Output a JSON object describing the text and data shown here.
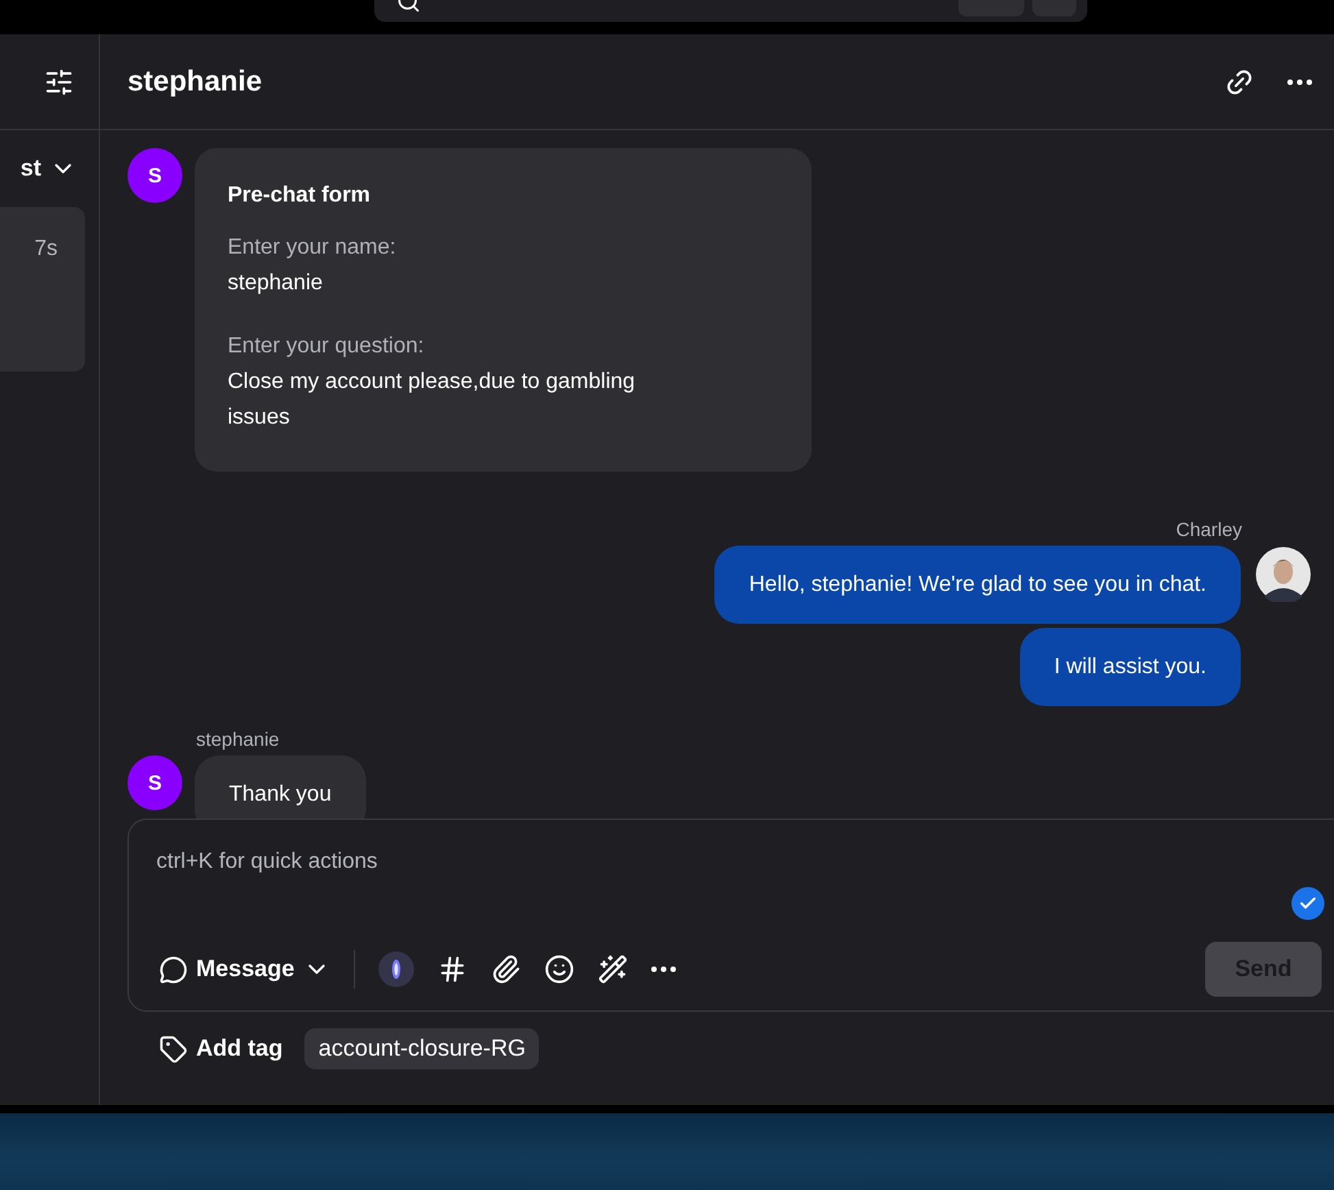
{
  "sidebar": {
    "filter_label": "st",
    "conversations": [
      {
        "time": "7s",
        "selected": true
      }
    ]
  },
  "chat": {
    "title": "stephanie"
  },
  "messages": [
    {
      "kind": "form",
      "avatar": "S",
      "title": "Pre-chat form",
      "fields": [
        {
          "label": "Enter your name:",
          "value": "stephanie"
        },
        {
          "label": "Enter your question:",
          "value": "Close my account please,due to gambling issues"
        }
      ]
    },
    {
      "kind": "agent",
      "sender": "Charley",
      "bubbles": [
        "Hello, stephanie! We're glad to see you in chat.",
        "I will assist you."
      ]
    },
    {
      "kind": "visitor",
      "sender": "stephanie",
      "avatar": "S",
      "bubbles": [
        "Thank you"
      ]
    }
  ],
  "composer": {
    "placeholder": "ctrl+K for quick actions",
    "mode": "Message",
    "send": "Send",
    "send_disabled": true
  },
  "tags": {
    "add_label": "Add tag",
    "items": [
      "account-closure-RG"
    ]
  }
}
